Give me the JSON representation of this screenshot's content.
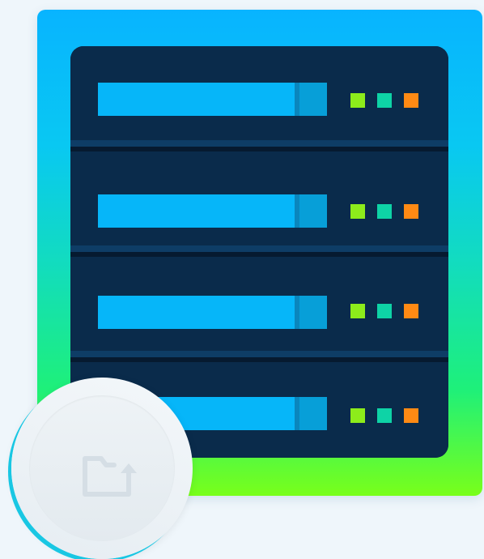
{
  "illustration": {
    "name": "server-rack-illustration",
    "units": [
      {
        "leds": [
          "#8dec1b",
          "#0ed3a6",
          "#ff8a14"
        ]
      },
      {
        "leds": [
          "#8dec1b",
          "#0ed3a6",
          "#ff8a14"
        ]
      },
      {
        "leds": [
          "#8dec1b",
          "#0ed3a6",
          "#ff8a14"
        ]
      },
      {
        "leds": [
          "#8dec1b",
          "#0ed3a6",
          "#ff8a14"
        ]
      }
    ]
  },
  "badge": {
    "icon": "folder-upload-icon"
  },
  "colors": {
    "background": "#eff6fb",
    "rack": "#0a2b4b",
    "bar": "#06b6f9",
    "badge_ring": "#19c7e3"
  }
}
